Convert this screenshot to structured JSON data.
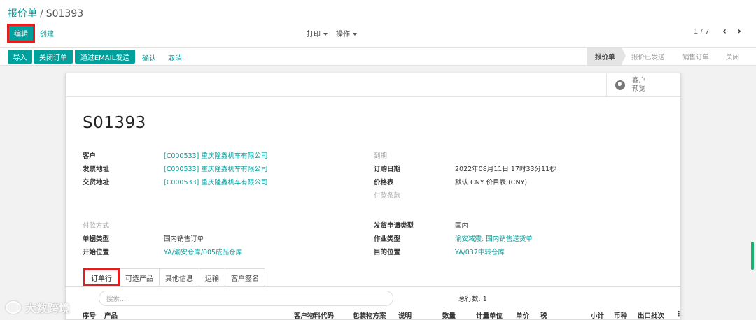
{
  "breadcrumb": {
    "parent": "报价单",
    "separator": "/",
    "current": "S01393"
  },
  "toolbar": {
    "edit_label": "编辑",
    "create_label": "创建",
    "print_label": "打印",
    "action_label": "操作",
    "pager": "1 / 7"
  },
  "statusbar": {
    "buttons": [
      "导入",
      "关闭订单",
      "通过EMAIL发送"
    ],
    "links": [
      "确认",
      "取消"
    ],
    "stages": [
      {
        "label": "报价单",
        "active": true
      },
      {
        "label": "报价已发送",
        "active": false
      },
      {
        "label": "销售订单",
        "active": false
      },
      {
        "label": "关闭",
        "active": false
      }
    ]
  },
  "smart_button": {
    "line1": "客户",
    "line2": "预览"
  },
  "form": {
    "title": "S01393",
    "left": [
      {
        "label": "客户",
        "value": "[C000533] 重庆隆鑫机车有限公司"
      },
      {
        "label": "发票地址",
        "value": "[C000533] 重庆隆鑫机车有限公司"
      },
      {
        "label": "交货地址",
        "value": "[C000533] 重庆隆鑫机车有限公司"
      }
    ],
    "right": [
      {
        "label": "到期",
        "value": ""
      },
      {
        "label": "订购日期",
        "value": "2022年08月11日 17时33分11秒"
      },
      {
        "label": "价格表",
        "value": "默认 CNY 价目表 (CNY)"
      },
      {
        "label": "付款条款",
        "value": ""
      }
    ],
    "left2": [
      {
        "label": "付款方式",
        "value": ""
      },
      {
        "label": "单据类型",
        "value": "国内销售订单"
      },
      {
        "label": "开始位置",
        "value": "YA/渝安仓库/005成品仓库"
      }
    ],
    "right2": [
      {
        "label": "发货申请类型",
        "value": "国内"
      },
      {
        "label": "作业类型",
        "value": "渝安减震: 国内销售送货单"
      },
      {
        "label": "目的位置",
        "value": "YA/037中转仓库"
      }
    ]
  },
  "tabs": [
    "订单行",
    "可选产品",
    "其他信息",
    "运输",
    "客户签名"
  ],
  "order_lines": {
    "search_placeholder": "搜索...",
    "total": "总行数: 1",
    "columns": [
      "序号",
      "产品",
      "客户物料代码",
      "包装物方案",
      "说明",
      "数量",
      "计量单位",
      "单价",
      "税",
      "小计",
      "币种",
      "出口批次"
    ]
  },
  "watermark": "大数跨境",
  "colors": {
    "accent": "#00A09D",
    "highlight": "#E02020"
  }
}
